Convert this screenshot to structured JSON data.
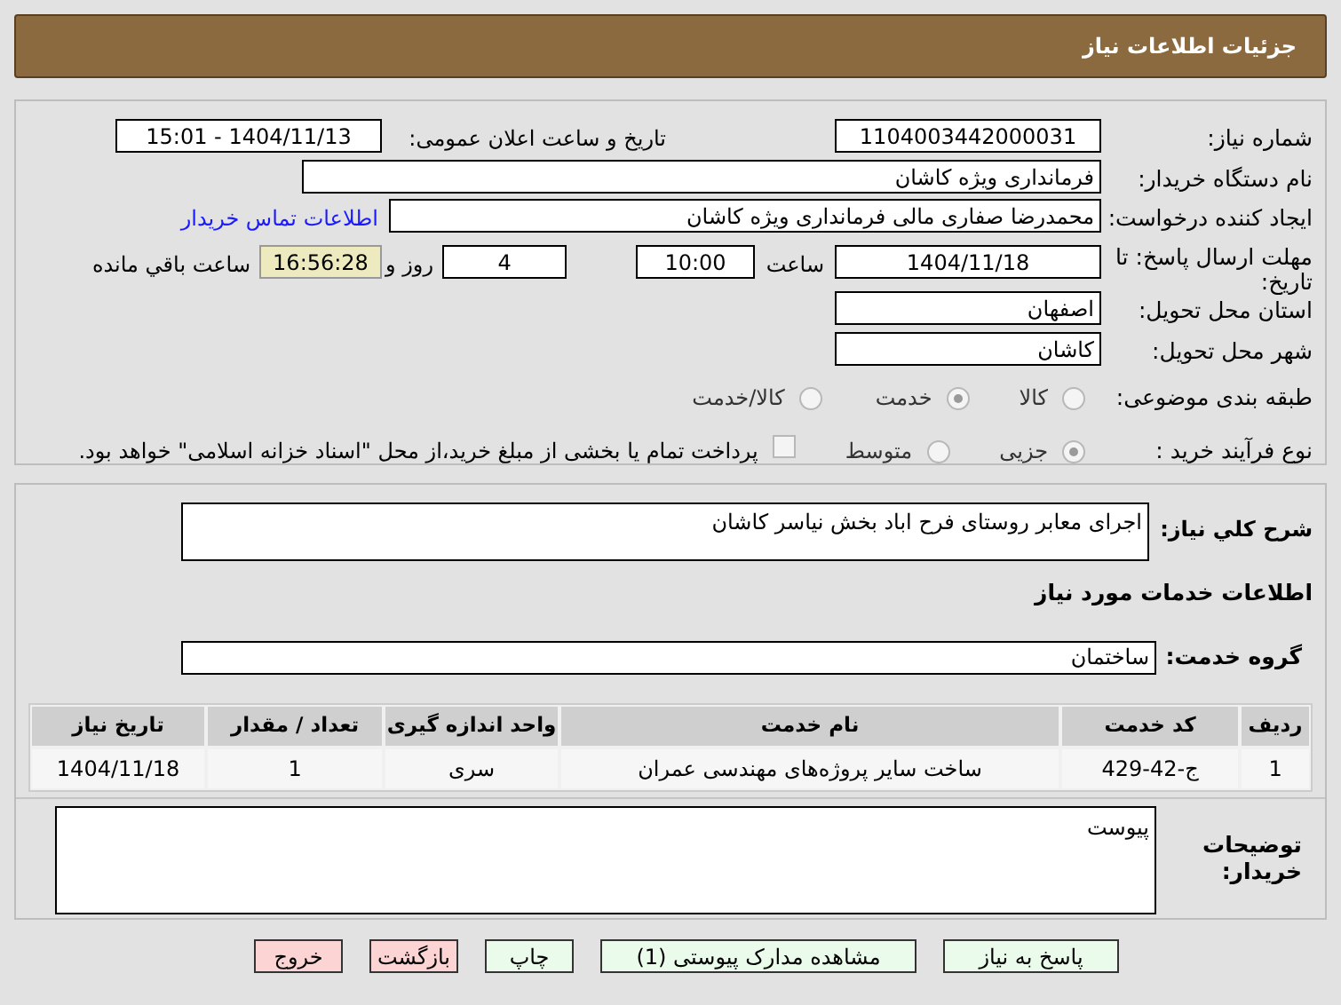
{
  "header": {
    "title": "جزئیات اطلاعات نیاز"
  },
  "need_number": {
    "label": "شماره نیاز:",
    "value": "1104003442000031"
  },
  "announce_date": {
    "label": "تاریخ و ساعت اعلان عمومی:",
    "value": "1404/11/13 - 15:01"
  },
  "buyer_org": {
    "label": "نام دستگاه خریدار:",
    "value": "فرمانداری ویژه کاشان"
  },
  "requester": {
    "label": "ایجاد کننده درخواست:",
    "value": "محمدرضا صفاری مالی فرمانداری ویژه کاشان",
    "link": "اطلاعات تماس خریدار"
  },
  "deadline": {
    "label": "مهلت ارسال پاسخ: تا تاریخ:",
    "date": "1404/11/18",
    "time_label": "ساعت",
    "time": "10:00",
    "days": "4",
    "days_label": "روز و",
    "remaining": "16:56:28",
    "remaining_label": "ساعت باقي مانده"
  },
  "province": {
    "label": "استان محل تحویل:",
    "value": "اصفهان"
  },
  "city": {
    "label": "شهر محل تحویل:",
    "value": "کاشان"
  },
  "category": {
    "label": "طبقه بندی موضوعی:",
    "options": [
      {
        "label": "کالا",
        "selected": false
      },
      {
        "label": "خدمت",
        "selected": true
      },
      {
        "label": "کالا/خدمت",
        "selected": false
      }
    ]
  },
  "process": {
    "label": "نوع فرآیند خرید :",
    "options": [
      {
        "label": "جزیی",
        "selected": true
      },
      {
        "label": "متوسط",
        "selected": false
      }
    ],
    "payment": {
      "label": "پرداخت تمام یا بخشی از مبلغ خرید،از محل \"اسناد خزانه اسلامی\" خواهد بود.",
      "checked": false
    }
  },
  "description": {
    "label": "شرح کلي نياز:",
    "value": "اجرای معابر روستای فرح اباد بخش نیاسر کاشان"
  },
  "services_heading": "اطلاعات خدمات مورد نیاز",
  "service_group": {
    "label": "گروه خدمت:",
    "value": "ساختمان"
  },
  "table": {
    "columns": [
      "ردیف",
      "کد خدمت",
      "نام خدمت",
      "واحد اندازه گیری",
      "تعداد / مقدار",
      "تاریخ نیاز"
    ],
    "rows": [
      [
        "1",
        "ج-42-429",
        "ساخت سایر پروژه‌های مهندسی عمران",
        "سری",
        "1",
        "1404/11/18"
      ]
    ]
  },
  "buyer_notes": {
    "label": "توضیحات خریدار:",
    "value": "پیوست"
  },
  "buttons": [
    {
      "label": "پاسخ به نیاز",
      "kind": "green"
    },
    {
      "label": "مشاهده مدارک پیوستی (1)",
      "kind": "green"
    },
    {
      "label": "چاپ",
      "kind": "green"
    },
    {
      "label": "بازگشت",
      "kind": "red"
    },
    {
      "label": "خروج",
      "kind": "red"
    }
  ]
}
